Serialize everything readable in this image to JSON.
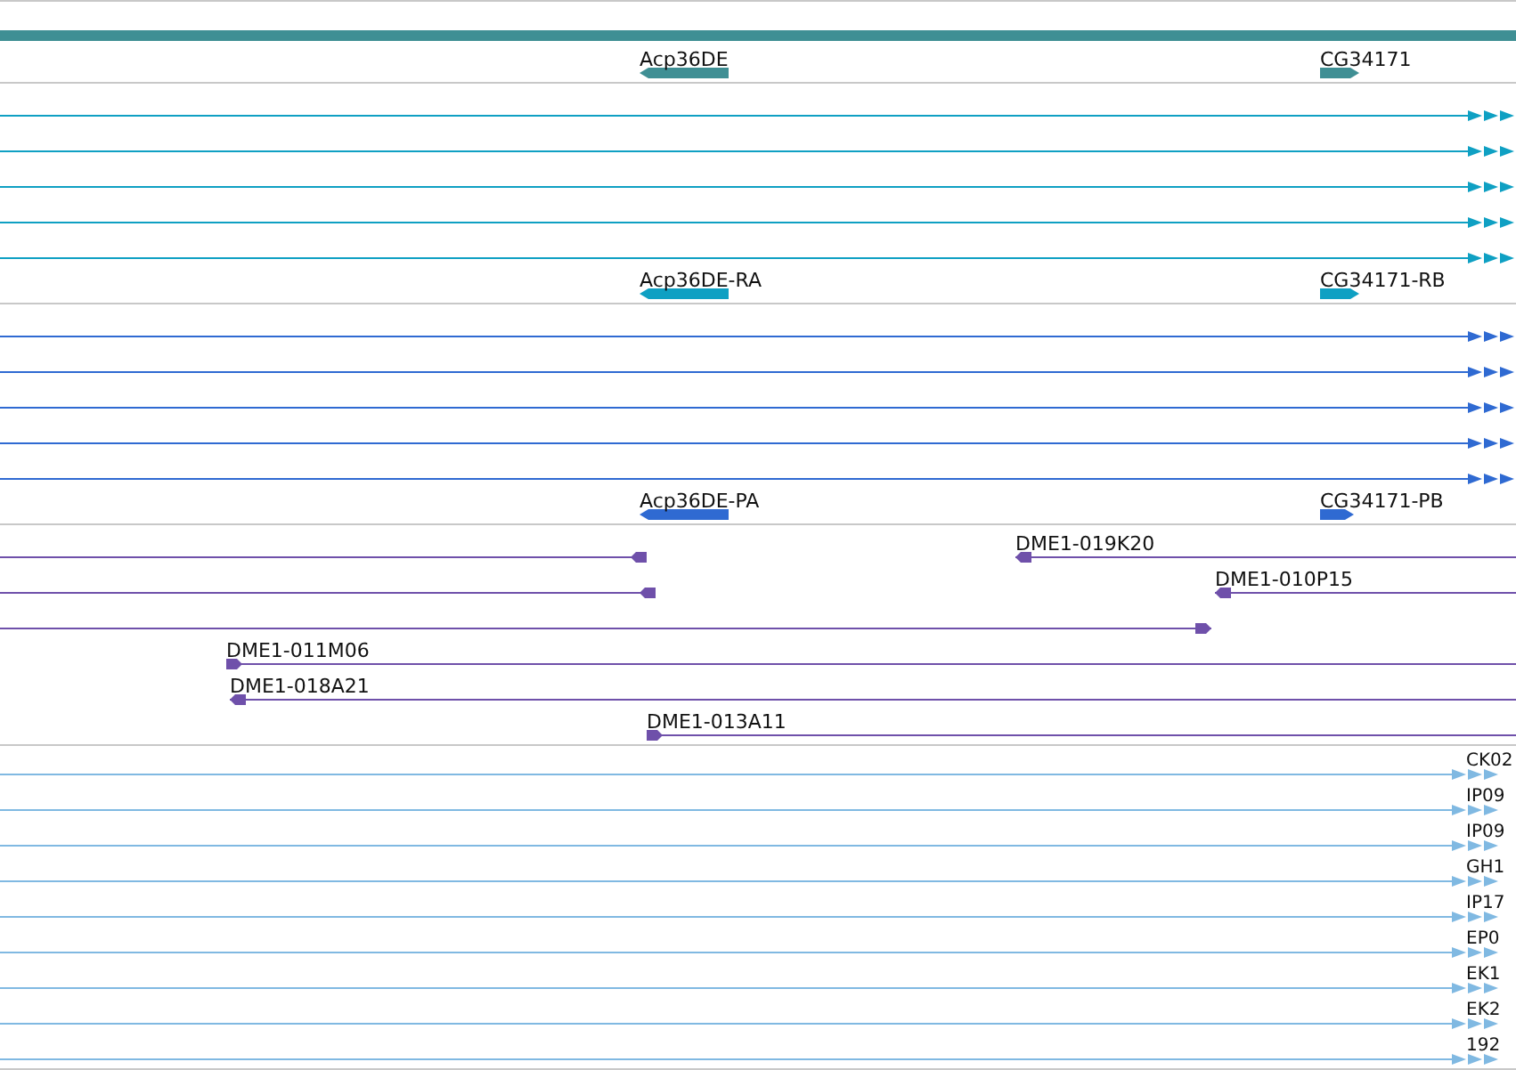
{
  "tracks": [
    {
      "kind": "gene",
      "color": "#3f8f94",
      "rows": [
        {
          "features": [
            {
              "label": "Acp36DE",
              "kind": "block",
              "forward": false
            },
            {
              "label": "CG34171",
              "kind": "block",
              "forward": true
            }
          ]
        }
      ]
    },
    {
      "kind": "transcript",
      "color": "#0fa0c3",
      "rows": [
        {
          "features": [
            {
              "kind": "span",
              "forward": true
            }
          ]
        },
        {
          "features": [
            {
              "kind": "span",
              "forward": true
            }
          ]
        },
        {
          "features": [
            {
              "kind": "span",
              "forward": true
            }
          ]
        },
        {
          "features": [
            {
              "kind": "span",
              "forward": true
            }
          ]
        },
        {
          "features": [
            {
              "kind": "span",
              "forward": true
            }
          ]
        },
        {
          "features": [
            {
              "label": "Acp36DE-RA",
              "kind": "block",
              "forward": false
            },
            {
              "label": "CG34171-RB",
              "kind": "block",
              "forward": true
            }
          ]
        }
      ]
    },
    {
      "kind": "transcript",
      "color": "#2f6ad2",
      "rows": [
        {
          "features": [
            {
              "kind": "span",
              "forward": true
            }
          ]
        },
        {
          "features": [
            {
              "kind": "span",
              "forward": true
            }
          ]
        },
        {
          "features": [
            {
              "kind": "span",
              "forward": true
            }
          ]
        },
        {
          "features": [
            {
              "kind": "span",
              "forward": true
            }
          ]
        },
        {
          "features": [
            {
              "kind": "span",
              "forward": true
            }
          ]
        },
        {
          "features": [
            {
              "label": "Acp36DE-PA",
              "kind": "block",
              "forward": false
            },
            {
              "label": "CG34171-PB",
              "kind": "block",
              "forward": true
            }
          ]
        }
      ]
    },
    {
      "kind": "clone",
      "color": "#6f50aa",
      "rows": [
        {
          "features": [
            {
              "kind": "clone",
              "forward": false
            },
            {
              "label": "DME1-019K20",
              "kind": "clone",
              "forward": false
            }
          ]
        },
        {
          "features": [
            {
              "kind": "clone",
              "forward": false
            },
            {
              "label": "DME1-010P15",
              "kind": "clone",
              "forward": false
            }
          ]
        },
        {
          "features": [
            {
              "kind": "clone",
              "forward": true
            }
          ]
        },
        {
          "features": [
            {
              "label": "DME1-011M06",
              "kind": "clone",
              "forward": true
            }
          ]
        },
        {
          "features": [
            {
              "label": "DME1-018A21",
              "kind": "clone",
              "forward": false
            }
          ]
        },
        {
          "features": [
            {
              "label": "DME1-013A11",
              "kind": "clone",
              "forward": true
            }
          ]
        }
      ]
    },
    {
      "kind": "est",
      "color": "#80b9e2",
      "rows": [
        {
          "features": [
            {
              "label": "CK02",
              "kind": "span",
              "forward": true
            }
          ]
        },
        {
          "features": [
            {
              "label": "IP09",
              "kind": "span",
              "forward": true
            }
          ]
        },
        {
          "features": [
            {
              "label": "IP09",
              "kind": "span",
              "forward": true
            }
          ]
        },
        {
          "features": [
            {
              "label": "GH1",
              "kind": "span",
              "forward": true
            }
          ]
        },
        {
          "features": [
            {
              "label": "IP17",
              "kind": "span",
              "forward": true
            }
          ]
        },
        {
          "features": [
            {
              "label": "EP0",
              "kind": "span",
              "forward": true
            }
          ]
        },
        {
          "features": [
            {
              "label": "EK1",
              "kind": "span",
              "forward": true
            }
          ]
        },
        {
          "features": [
            {
              "label": "EK2",
              "kind": "span",
              "forward": true
            }
          ]
        },
        {
          "features": [
            {
              "label": "192",
              "kind": "span",
              "forward": true
            }
          ]
        }
      ]
    }
  ]
}
